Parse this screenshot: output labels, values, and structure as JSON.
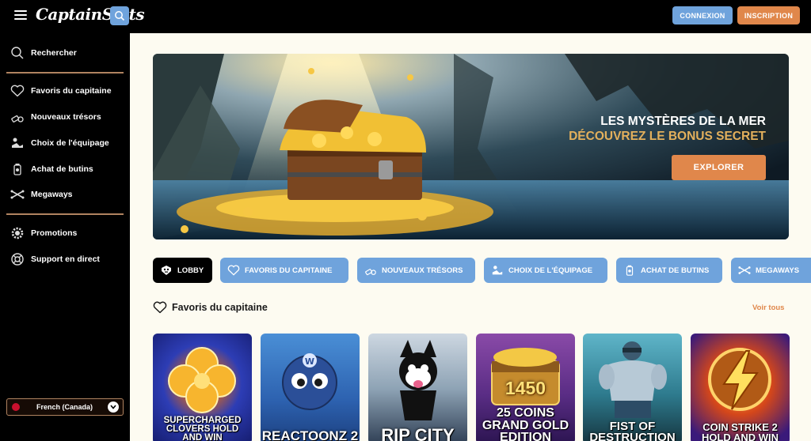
{
  "header": {
    "logo_text": "CaptainSlots",
    "login_label": "CONNEXION",
    "register_label": "INSCRIPTION"
  },
  "sidebar": {
    "search_label": "Rechercher",
    "items": [
      {
        "label": "Favoris du capitaine",
        "icon": "heart-icon"
      },
      {
        "label": "Nouveaux trésors",
        "icon": "new-treasures-icon"
      },
      {
        "label": "Choix de l'équipage",
        "icon": "crew-choice-icon"
      },
      {
        "label": "Achat de butins",
        "icon": "loot-purchase-icon"
      },
      {
        "label": "Megaways",
        "icon": "megaways-icon"
      }
    ],
    "secondary": [
      {
        "label": "Promotions",
        "icon": "gear-icon"
      },
      {
        "label": "Support en direct",
        "icon": "lifebuoy-icon"
      }
    ],
    "language": "French (Canada)"
  },
  "hero": {
    "title_line1": "LES MYSTÈRES DE LA MER",
    "title_line2": "DÉCOUVREZ LE BONUS SECRET",
    "cta_label": "EXPLORER"
  },
  "tabs": [
    {
      "label": "LOBBY",
      "active": true
    },
    {
      "label": "FAVORIS DU CAPITAINE",
      "active": false
    },
    {
      "label": "NOUVEAUX TRÉSORS",
      "active": false
    },
    {
      "label": "CHOIX DE L'ÉQUIPAGE",
      "active": false
    },
    {
      "label": "ACHAT DE BUTINS",
      "active": false
    },
    {
      "label": "MEGAWAYS",
      "active": false
    }
  ],
  "section": {
    "title": "Favoris du capitaine",
    "see_all": "Voir tous"
  },
  "games": [
    {
      "title": "SUPERCHARGED CLOVERS HOLD AND WIN"
    },
    {
      "title": "REACTOONZ 2"
    },
    {
      "title": "RIP CITY"
    },
    {
      "title": "25 COINS GRAND GOLD EDITION",
      "badge": "1450"
    },
    {
      "title": "FIST OF DESTRUCTION"
    },
    {
      "title": "COIN STRIKE 2 HOLD AND WIN"
    }
  ],
  "colors": {
    "accent_blue": "#6fa3dc",
    "accent_orange": "#e0874b",
    "gold": "#e3b05c",
    "background": "#fdfbf1"
  }
}
